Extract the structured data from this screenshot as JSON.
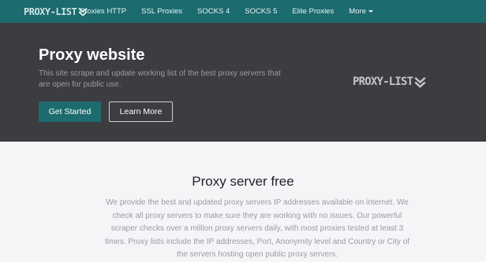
{
  "navbar": {
    "brand": "PROXY-LIST",
    "items": [
      {
        "label": "Proxies HTTP"
      },
      {
        "label": "SSL Proxies"
      },
      {
        "label": "SOCKS 4"
      },
      {
        "label": "SOCKS 5"
      },
      {
        "label": "Elite Proxies"
      },
      {
        "label": "More"
      }
    ]
  },
  "hero": {
    "title": "Proxy website",
    "subtitle": "This site scrape and update working list of the best proxy servers that are open for public use.",
    "primary_button": "Get Started",
    "secondary_button": "Learn More",
    "logo_text": "PROXY-LIST"
  },
  "main": {
    "title": "Proxy server free",
    "text": "We provide the best and updated proxy servers IP addresses available on internet. We check all proxy servers to make sure they are working with no issues. Our powerful scraper checks over a million proxy servers daily, with most proxies tested at least 3 times. Proxy lists include the IP addresses, Port, Anonymity level and Country or City of the servers hosting open public proxy servers."
  },
  "colors": {
    "navbar": "#1c6b6e",
    "hero_bg": "#3c3d41",
    "page_bg": "#f4f5f7",
    "accent": "#1c6b6e"
  }
}
